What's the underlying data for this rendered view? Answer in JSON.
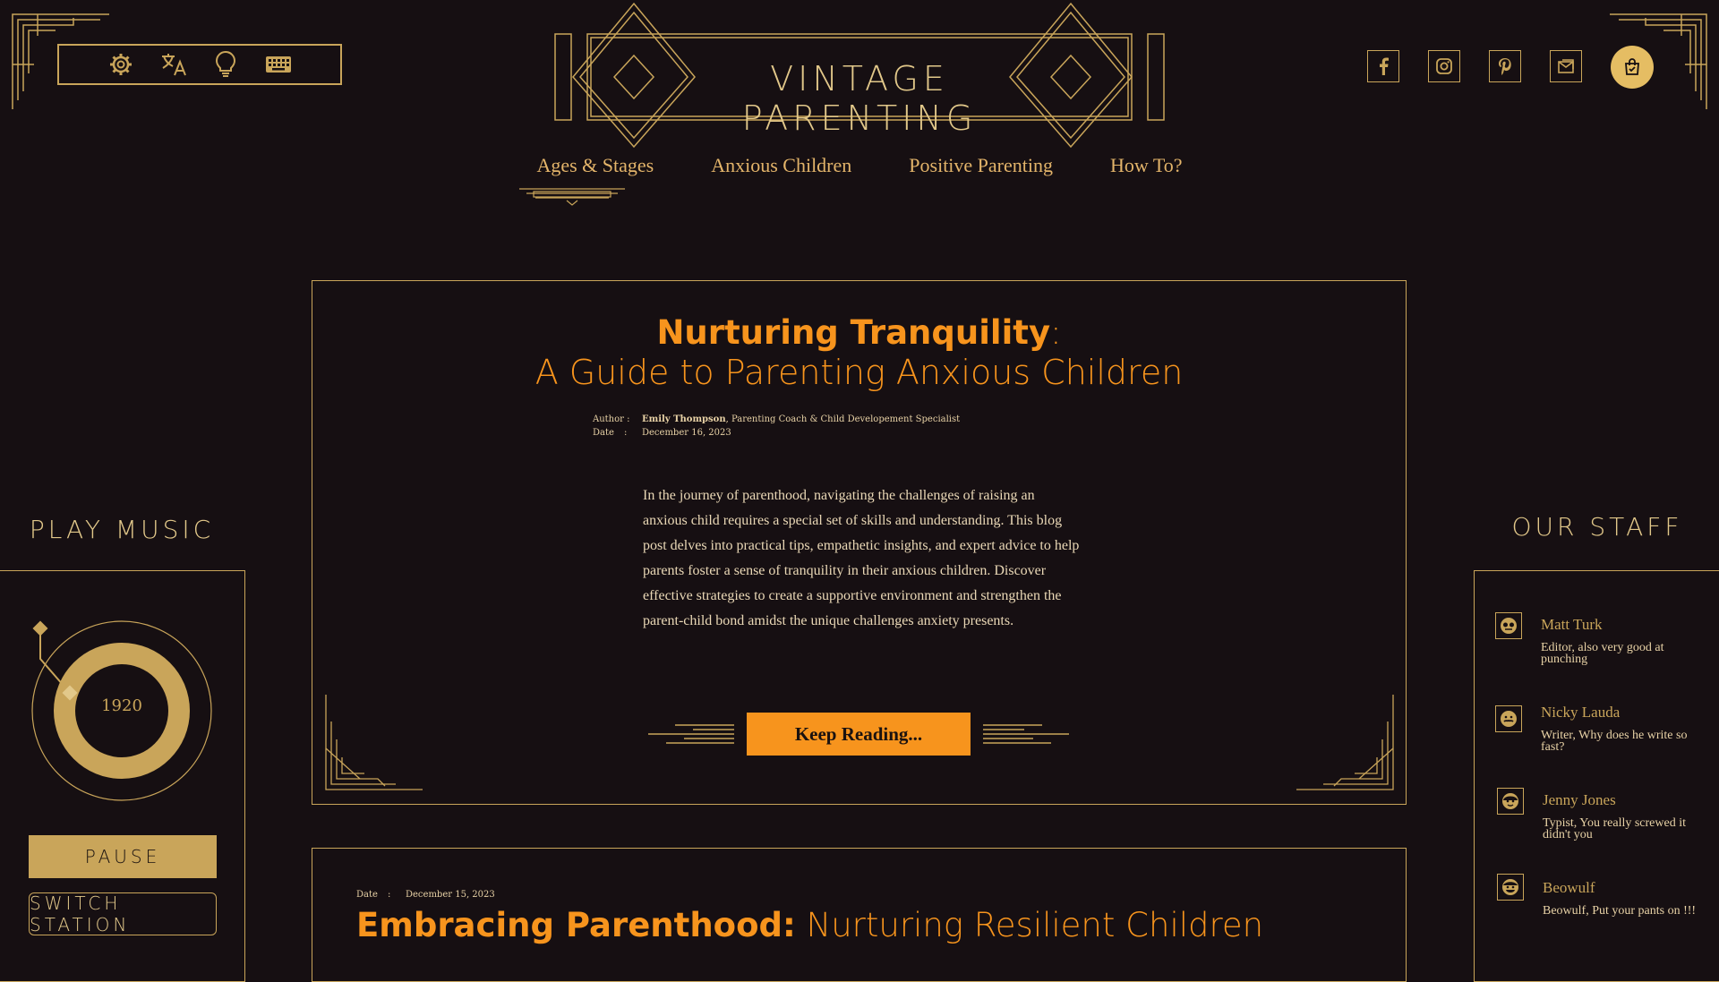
{
  "header": {
    "site_title": "VINTAGE PARENTING",
    "toolbar_icons": [
      "gear-icon",
      "translate-icon",
      "lightbulb-icon",
      "keyboard-icon"
    ],
    "nav": [
      "Ages & Stages",
      "Anxious Children",
      "Positive Parenting",
      "How To?"
    ],
    "social_icons": [
      "facebook-icon",
      "instagram-icon",
      "pinterest-icon",
      "mail-icon",
      "shopping-bag-icon"
    ]
  },
  "music": {
    "title": "PLAY MUSIC",
    "record_label": "1920",
    "pause_label": "PAUSE",
    "switch_label": "SWITCH STATION"
  },
  "staff": {
    "title": "OUR STAFF",
    "members": [
      {
        "name": "Matt Turk",
        "role": "Editor, also very good at punching"
      },
      {
        "name": "Nicky Lauda",
        "role": "Writer, Why does he write so fast?"
      },
      {
        "name": "Jenny Jones",
        "role": "Typist, You really screwed it didn't you"
      },
      {
        "name": "Beowulf",
        "role": "Beowulf, Put your pants on !!!"
      }
    ]
  },
  "article1": {
    "title": "Nurturing Tranquility",
    "title_colon": ":",
    "subtitle": "A Guide to Parenting Anxious Children",
    "author_label": "Author :",
    "author_name": "Emily Thompson",
    "author_role": ", Parenting Coach & Child Developement Specialist",
    "date_label": "Date",
    "date_sep": ":",
    "date": "December 16, 2023",
    "body": "In the journey of parenthood, navigating the challenges of raising an anxious child requires a special set of skills and understanding. This blog post delves into practical tips, empathetic insights, and expert advice to help parents foster a sense of tranquility in their anxious children. Discover effective strategies to create a supportive environment and strengthen the parent-child bond amidst the unique challenges anxiety presents.",
    "cta": "Keep Reading..."
  },
  "article2": {
    "date_label": "Date",
    "date_sep": ":",
    "date": "December 15, 2023",
    "title_bold": "Embracing Parenthood:",
    "title_rest": " Nurturing Resilient Children"
  },
  "colors": {
    "background": "#160f12",
    "gold": "#c9a55a",
    "orange": "#f7941d"
  }
}
